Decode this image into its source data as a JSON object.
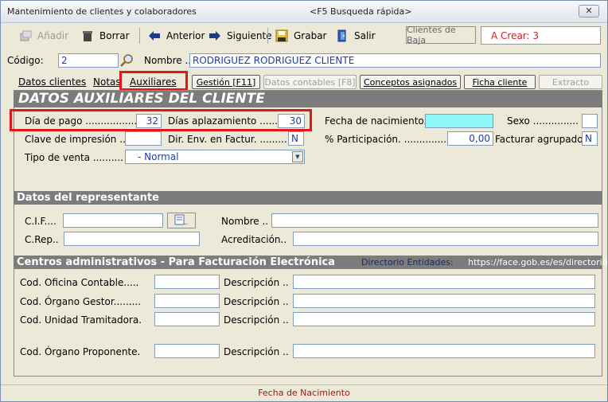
{
  "window": {
    "title": "Mantenimiento de clientes y colaboradores",
    "subtitle": "<F5 Busqueda rápida>",
    "close_label": "✕"
  },
  "toolbar": {
    "anadir": "Añadir",
    "borrar": "Borrar",
    "anterior": "Anterior",
    "siguiente": "Siguiente",
    "grabar": "Grabar",
    "salir": "Salir",
    "clientes_baja": "Clientes de Baja",
    "a_crear": "A Crear: 3"
  },
  "header": {
    "codigo_label": "Código:",
    "codigo_value": "2",
    "nombre_label": "Nombre ..",
    "nombre_value": "RODRIGUEZ RODRIGUEZ CLIENTE"
  },
  "tabs": {
    "datos_clientes": "Datos clientes",
    "notas": "Notas",
    "auxiliares": "Auxiliares",
    "gestion": "Gestión [F11]",
    "datos_contables": "Datos contables [F8]",
    "conceptos": "Conceptos asignados",
    "ficha": "Ficha cliente",
    "extracto": "Extracto"
  },
  "aux": {
    "title": "DATOS AUXILIARES DEL CLIENTE",
    "dia_pago_label": "Día de pago ..................",
    "dia_pago_value": "32",
    "dias_aplaz_label": "Días aplazamiento ........",
    "dias_aplaz_value": "30",
    "fecha_nac_label": "Fecha de nacimiento..",
    "fecha_nac_value": "",
    "sexo_label": "Sexo ...............",
    "sexo_value": "",
    "clave_imp_label": "Clave de impresión ..",
    "clave_imp_value": "",
    "dir_env_label": "Dir. Env. en Factur. .........",
    "dir_env_value": "N",
    "participacion_label": "% Participación. ..............",
    "participacion_value": "0,00",
    "fact_agrup_label": "Facturar agrupado",
    "fact_agrup_value": "N",
    "tipo_venta_label": "Tipo de venta ..........",
    "tipo_venta_value": "- Normal"
  },
  "representante": {
    "title": "Datos del representante",
    "cif_label": "C.I.F....",
    "cif_value": "",
    "nombre_label": "Nombre ..",
    "nombre_value": "",
    "crep_label": "C.Rep..",
    "crep_value": "",
    "acreditacion_label": "Acreditación..",
    "acreditacion_value": ""
  },
  "centros": {
    "title": "Centros administrativos - Para Facturación Electrónica",
    "directorio_label": "Directorio Entidades:",
    "directorio_url": "https://face.gob.es/es/directorio",
    "rows": [
      {
        "label": "Cod. Oficina Contable.....",
        "desc_label": "Descripción .."
      },
      {
        "label": "Cod. Órgano Gestor.........",
        "desc_label": "Descripción .."
      },
      {
        "label": "Cod. Unidad Tramitadora.",
        "desc_label": "Descripción .."
      },
      {
        "label": "Cod. Órgano Proponente.",
        "desc_label": "Descripción .."
      }
    ]
  },
  "status": {
    "text": "Fecha de Nacimiento"
  },
  "colors": {
    "accent_red": "#e01818",
    "header_gray": "#7c7c7c",
    "cyan_field": "#8ef7f9"
  }
}
